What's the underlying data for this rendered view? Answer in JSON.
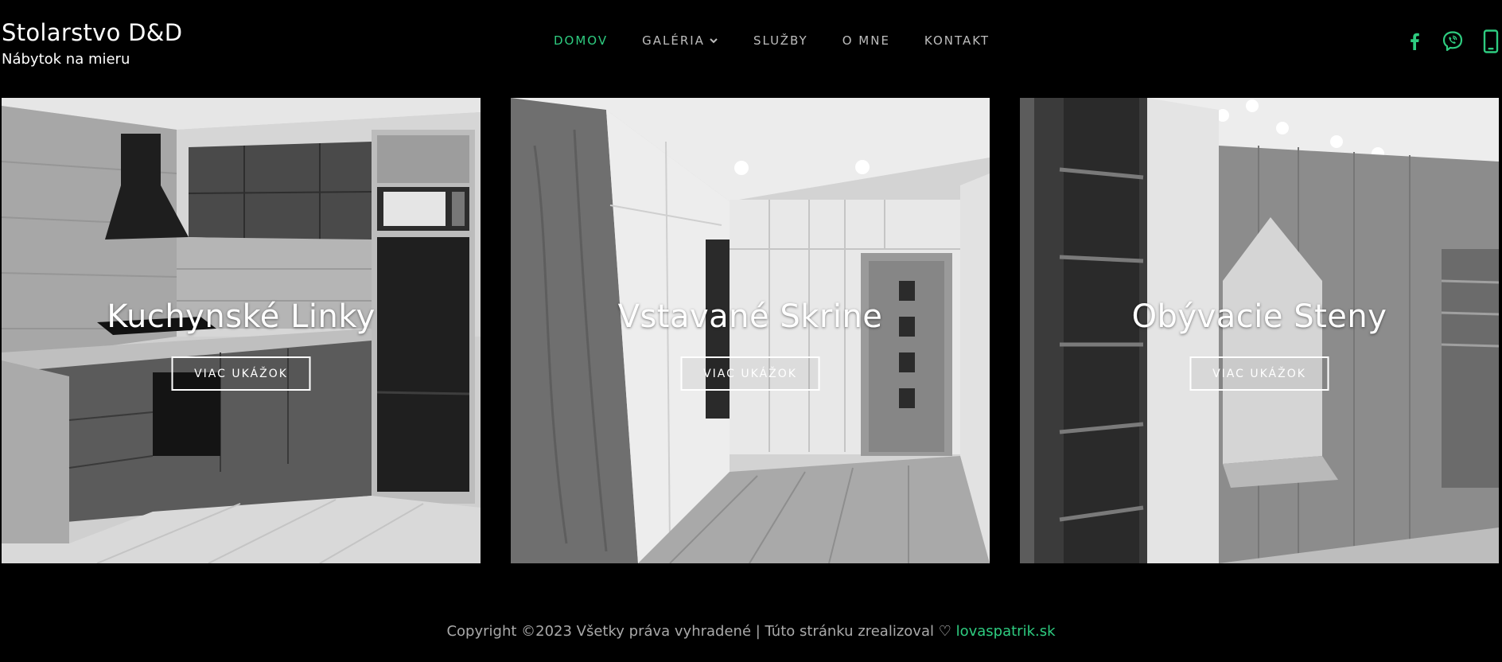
{
  "brand": {
    "title": "Stolarstvo D&D",
    "subtitle": "Nábytok na mieru"
  },
  "nav": {
    "items": [
      {
        "label": "DOMOV",
        "active": true
      },
      {
        "label": "GALÉRIA",
        "dropdown": true
      },
      {
        "label": "SLUŽBY"
      },
      {
        "label": "O MNE"
      },
      {
        "label": "KONTAKT"
      }
    ]
  },
  "social": {
    "accent": "#2ecc80",
    "icons": [
      "facebook-icon",
      "viber-icon",
      "phone-icon"
    ]
  },
  "cards": [
    {
      "title": "Kuchynské Linky",
      "button": "VIAC UKÁŽOK"
    },
    {
      "title": "Vstavané Skrine",
      "button": "VIAC UKÁŽOK"
    },
    {
      "title": "Obývacie Steny",
      "button": "VIAC UKÁŽOK"
    }
  ],
  "footer": {
    "text": "Copyright ©2023 Všetky práva vyhradené | Túto stránku zrealizoval",
    "heart": "♡",
    "link": "lovaspatrik.sk"
  }
}
